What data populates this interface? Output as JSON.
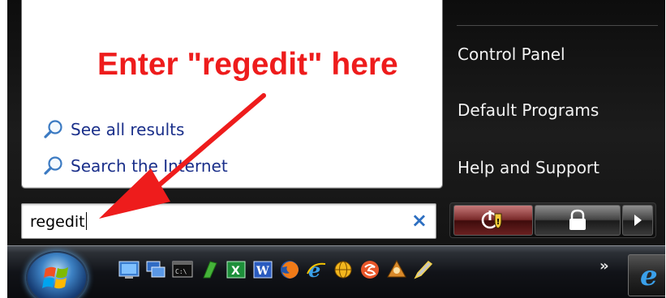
{
  "start_menu": {
    "results": [
      {
        "label": "See all results",
        "icon": "magnifier-icon"
      },
      {
        "label": "Search the Internet",
        "icon": "magnifier-icon"
      }
    ],
    "search": {
      "value": "regedit",
      "clear_icon": "×"
    },
    "right_column": {
      "items": [
        "Control Panel",
        "Default Programs",
        "Help and Support"
      ]
    },
    "power": {
      "buttons": [
        "power-button",
        "lock-button",
        "options-arrow-button"
      ]
    }
  },
  "annotation": {
    "text": "Enter \"regedit\" here",
    "color": "#ee1c1c"
  },
  "taskbar": {
    "start_button": "windows-orb",
    "quick_launch": [
      "show-desktop-icon",
      "switch-windows-icon",
      "command-prompt-icon",
      "green-app-icon",
      "excel-icon",
      "word-icon",
      "firefox-icon",
      "internet-explorer-icon",
      "globe-icon",
      "orange-swirl-icon",
      "character-icon",
      "pen-tool-icon"
    ],
    "overflow_glyph": "»",
    "pinned_task": "internet-explorer-icon"
  }
}
